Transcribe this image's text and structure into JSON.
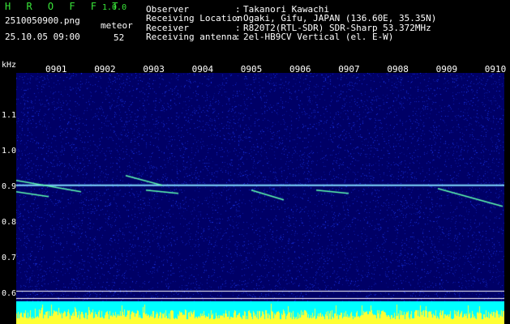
{
  "header": {
    "app_name": "H R O F F T",
    "version": "1.0.0",
    "filename": "2510050900.png",
    "datetime": "25.10.05 09:00",
    "meteor_label": "meteor",
    "meteor_count": "52",
    "info": [
      {
        "key": "Observer",
        "value": "Takanori Kawachi"
      },
      {
        "key": "Receiving Location",
        "value": "Ogaki, Gifu, JAPAN (136.60E, 35.35N)"
      },
      {
        "key": "Receiver",
        "value": "R820T2(RTL-SDR) SDR-Sharp 53.372MHz"
      },
      {
        "key": "Receiving antenna",
        "value": "2el-HB9CV Vertical (el. E-W)"
      }
    ]
  },
  "spectrogram": {
    "freq_unit": "kHz",
    "time_labels": [
      "0901",
      "0902",
      "0903",
      "0904",
      "0905",
      "0906",
      "0907",
      "0908",
      "0909",
      "0910"
    ],
    "freq_labels": [
      "1.1",
      "1.0",
      "0.9",
      "0.8",
      "0.7",
      "0.6"
    ],
    "freq_range_khz": [
      0.58,
      1.22
    ],
    "carrier_khz": 0.905,
    "colors": {
      "background": "#000066",
      "noise": "#1e3dff",
      "carrier": "#7fd9ff",
      "echo": "#5fffb0",
      "baseline": "#00ffff",
      "bars": "#ffff33",
      "gridline": "#ffffff"
    }
  }
}
